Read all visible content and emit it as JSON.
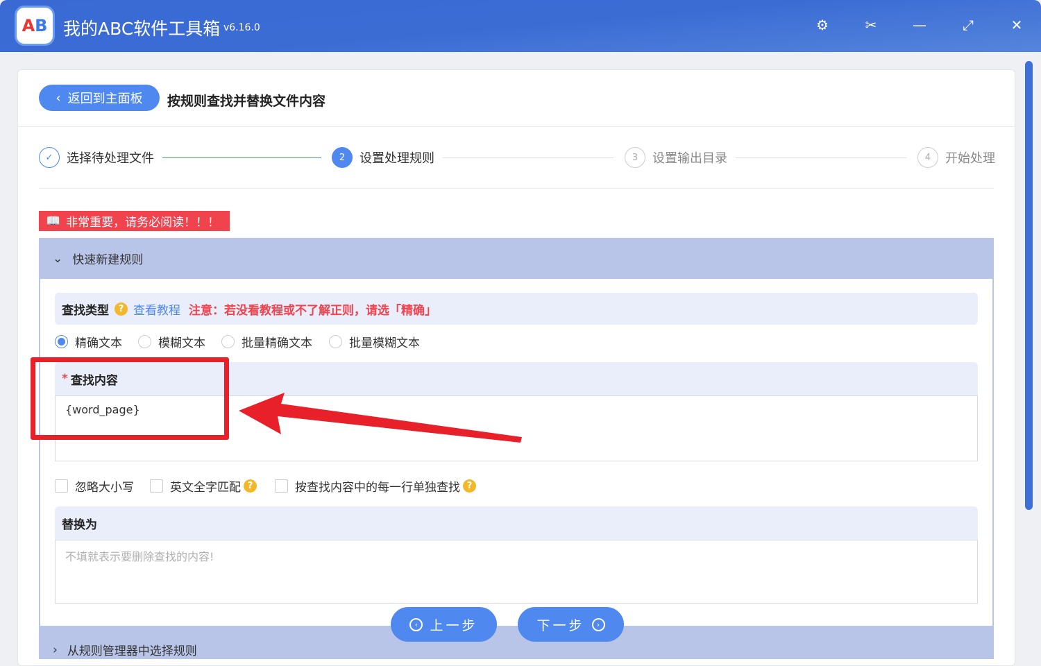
{
  "app": {
    "title": "我的ABC软件工具箱",
    "version": "v6.16.0",
    "logo_text": "AB"
  },
  "header": {
    "back_label": "返回到主面板",
    "page_title": "按规则查找并替换文件内容"
  },
  "steps": [
    {
      "num": "✓",
      "label": "选择待处理文件"
    },
    {
      "num": "2",
      "label": "设置处理规则"
    },
    {
      "num": "3",
      "label": "设置输出目录"
    },
    {
      "num": "4",
      "label": "开始处理"
    }
  ],
  "notice": "非常重要，请务必阅读！！！",
  "quick_rule": {
    "title": "快速新建规则"
  },
  "search_type": {
    "label": "查找类型",
    "tutorial": "查看教程",
    "warning": "注意：若没看教程或不了解正则，请选「精确」",
    "options": [
      "精确文本",
      "模糊文本",
      "批量精确文本",
      "批量模糊文本"
    ],
    "selected": "精确文本"
  },
  "find": {
    "required": "*",
    "label": "查找内容",
    "value": "{word_page}"
  },
  "options": [
    "忽略大小写",
    "英文全字匹配",
    "按查找内容中的每一行单独查找"
  ],
  "replace": {
    "label": "替换为",
    "placeholder": "不填就表示要删除查找的内容!"
  },
  "buttons": {
    "prev": "上一步",
    "next": "下一步"
  },
  "rule_manager": {
    "title": "从规则管理器中选择规则"
  },
  "colors": {
    "accent": "#4f88ef",
    "danger": "#f0434e",
    "highlight": "#e8202a"
  }
}
